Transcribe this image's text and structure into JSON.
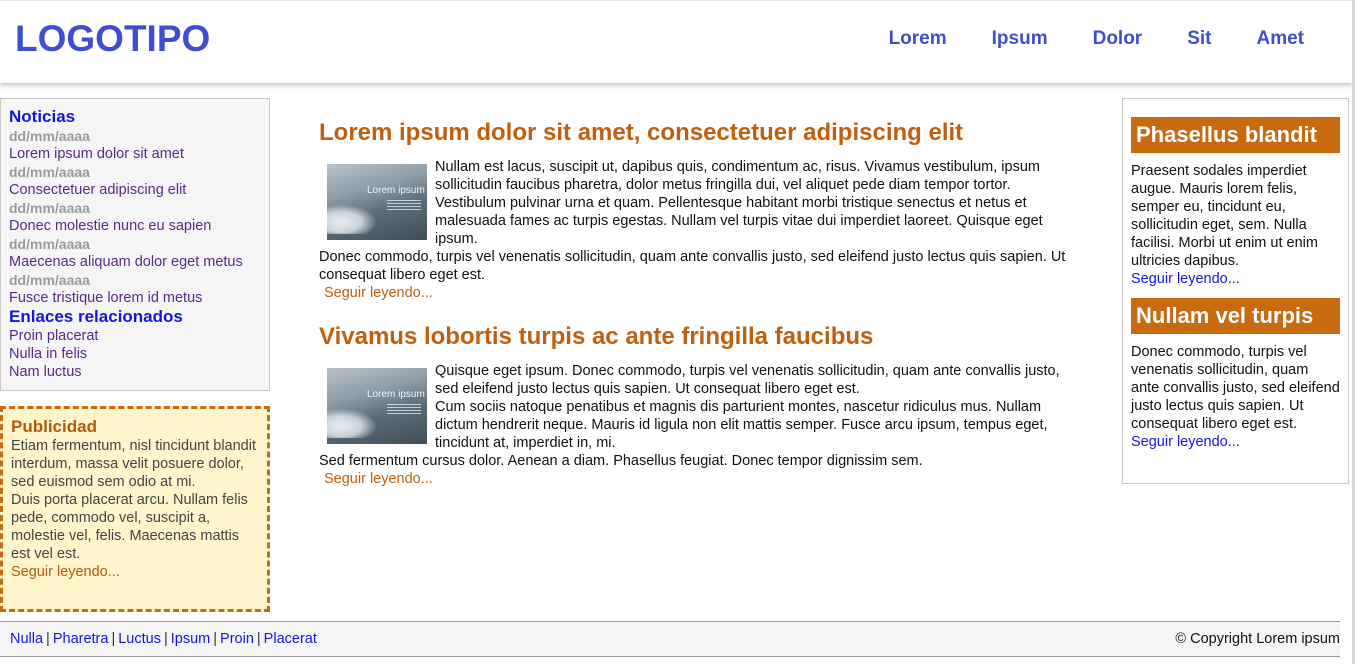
{
  "header": {
    "logo": "LOGOTIPO",
    "nav": [
      "Lorem",
      "Ipsum",
      "Dolor",
      "Sit",
      "Amet"
    ]
  },
  "news": {
    "title": "Noticias",
    "items": [
      {
        "date": "dd/mm/aaaa",
        "label": "Lorem ipsum dolor sit amet"
      },
      {
        "date": "dd/mm/aaaa",
        "label": "Consectetuer adipiscing elit"
      },
      {
        "date": "dd/mm/aaaa",
        "label": "Donec molestie nunc eu sapien"
      },
      {
        "date": "dd/mm/aaaa",
        "label": "Maecenas aliquam dolor eget metus"
      },
      {
        "date": "dd/mm/aaaa",
        "label": "Fusce tristique lorem id metus"
      }
    ],
    "related_title": "Enlaces relacionados",
    "related": [
      "Proin placerat",
      "Nulla in felis",
      "Nam luctus"
    ]
  },
  "ad": {
    "title": "Publicidad",
    "p1": "Etiam fermentum, nisl tincidunt blandit interdum, massa velit posuere dolor, sed euismod sem odio at mi.",
    "p2": "Duis porta placerat arcu. Nullam felis pede, commodo vel, suscipit a, molestie vel, felis. Maecenas mattis est vel est.",
    "more": "Seguir leyendo..."
  },
  "articles": [
    {
      "title": "Lorem ipsum dolor sit amet, consectetuer adipiscing elit",
      "thumb_text": "Lorem ipsum",
      "p1": "Nullam est lacus, suscipit ut, dapibus quis, condimentum ac, risus. Vivamus vestibulum, ipsum sollicitudin faucibus pharetra, dolor metus fringilla dui, vel aliquet pede diam tempor tortor.",
      "p2": "Vestibulum pulvinar urna et quam. Pellentesque habitant morbi tristique senectus et netus et malesuada fames ac turpis egestas. Nullam vel turpis vitae dui imperdiet laoreet. Quisque eget ipsum.",
      "p3": "Donec commodo, turpis vel venenatis sollicitudin, quam ante convallis justo, sed eleifend justo lectus quis sapien. Ut consequat libero eget est.",
      "more": "Seguir leyendo..."
    },
    {
      "title": "Vivamus lobortis turpis ac ante fringilla faucibus",
      "thumb_text": "Lorem ipsum",
      "p1": "Quisque eget ipsum. Donec commodo, turpis vel venenatis sollicitudin, quam ante convallis justo, sed eleifend justo lectus quis sapien. Ut consequat libero eget est.",
      "p2": "Cum sociis natoque penatibus et magnis dis parturient montes, nascetur ridiculus mus. Nullam dictum hendrerit neque. Mauris id ligula non elit mattis semper. Fusce arcu ipsum, tempus eget, tincidunt at, imperdiet in, mi.",
      "p3": "Sed fermentum cursus dolor. Aenean a diam. Phasellus feugiat. Donec tempor dignissim sem.",
      "more": "Seguir leyendo..."
    }
  ],
  "right": [
    {
      "title": "Phasellus blandit",
      "text": "Praesent sodales imperdiet augue. Mauris lorem felis, semper eu, tincidunt eu, sollicitudin eget, sem. Nulla facilisi. Morbi ut enim ut enim ultricies dapibus.",
      "more": "Seguir leyendo..."
    },
    {
      "title": "Nullam vel turpis",
      "text": "Donec commodo, turpis vel venenatis sollicitudin, quam ante convallis justo, sed eleifend justo lectus quis sapien. Ut consequat libero eget est.",
      "more": "Seguir leyendo..."
    }
  ],
  "footer": {
    "links": [
      "Nulla",
      "Pharetra",
      "Luctus",
      "Ipsum",
      "Proin",
      "Placerat"
    ],
    "separator": "|",
    "copyright": "© Copyright Lorem ipsum"
  },
  "colors": {
    "brand_blue": "#3f4dd1",
    "accent_orange": "#c86a10",
    "ad_background": "#fff5cc"
  }
}
